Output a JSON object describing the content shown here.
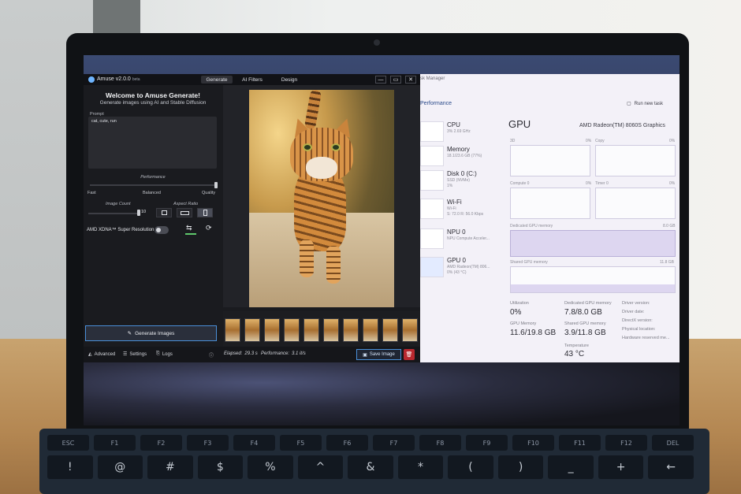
{
  "amuse": {
    "title": "Amuse v2.0.0",
    "beta": "beta",
    "tabs": [
      "Generate",
      "AI Filters",
      "Design"
    ],
    "window_buttons": [
      "—",
      "▭",
      "✕"
    ],
    "welcome_title": "Welcome to Amuse Generate!",
    "welcome_subtitle": "Generate images using AI and Stable Diffusion",
    "prompt_label": "Prompt",
    "prompt_value": "cat, cute, run",
    "performance_label": "Performance",
    "performance_options": [
      "Fast",
      "Balanced",
      "Quality"
    ],
    "performance_level": 1.0,
    "image_count_label": "Image Count",
    "image_count_value": "10",
    "aspect_ratio_label": "Aspect Ratio",
    "xdna_label": "AMD XDNA™ Super Resolution",
    "xdna_enabled": false,
    "generate_label": "Generate Images",
    "footer": {
      "advanced": "Advanced",
      "settings": "Settings",
      "logs": "Logs",
      "elapsed_label": "Elapsed:",
      "elapsed_value": "29.3 s",
      "performance_label": "Performance:",
      "performance_value": "3.1 it/s",
      "save_label": "Save Image"
    },
    "accent_color": "#4a8fd8",
    "delete_color": "#b8282f"
  },
  "taskmgr": {
    "title": "sk Manager",
    "section": "Performance",
    "run_new_task": "Run new task",
    "items": [
      {
        "name": "CPU",
        "line1": "3% 2.69 GHz",
        "line2": ""
      },
      {
        "name": "Memory",
        "line1": "18.1/23.6 GB (77%)",
        "line2": ""
      },
      {
        "name": "Disk 0 (C:)",
        "line1": "SSD (NVMe)",
        "line2": "1%"
      },
      {
        "name": "Wi-Fi",
        "line1": "Wi-Fi",
        "line2": "S: 72.0 R: 56.0 Kbps"
      },
      {
        "name": "NPU 0",
        "line1": "NPU Compute Acceler...",
        "line2": ""
      },
      {
        "name": "GPU 0",
        "line1": "AMD Radeon(TM) 806...",
        "line2": "0% (43 °C)"
      }
    ],
    "gpu_heading": "GPU",
    "gpu_name": "AMD Radeon(TM) 8060S Graphics",
    "graphs": [
      {
        "label": "3D",
        "pct": "0%"
      },
      {
        "label": "Copy",
        "pct": "0%"
      },
      {
        "label": "Compute 0",
        "pct": "0%"
      },
      {
        "label": "Timer 0",
        "pct": "0%"
      }
    ],
    "dedicated_label": "Dedicated GPU memory",
    "dedicated_max": "8.0 GB",
    "shared_label": "Shared GPU memory",
    "shared_max": "11.8 GB",
    "stats": {
      "utilization_label": "Utilization",
      "utilization_value": "0%",
      "dedicated_mem_label": "Dedicated GPU memory",
      "dedicated_mem_value": "7.8/8.0 GB",
      "gpu_memory_label": "GPU Memory",
      "gpu_memory_value": "11.6/19.8 GB",
      "shared_mem_label": "Shared GPU memory",
      "shared_mem_value": "3.9/11.8 GB",
      "temperature_label": "Temperature",
      "temperature_value": "43 °C"
    },
    "side_labels": [
      "Driver version:",
      "Driver date:",
      "DirectX version:",
      "Physical location:",
      "Hardware reserved me..."
    ]
  },
  "keyboard": {
    "row1": [
      "ESC",
      "F1",
      "F2",
      "F3",
      "F4",
      "F5",
      "F6",
      "F7",
      "F8",
      "F9",
      "F10",
      "F11",
      "F12",
      "DEL"
    ],
    "row2": [
      "!",
      "@",
      "#",
      "$",
      "%",
      "^",
      "&",
      "*",
      "(",
      ")",
      "_",
      "+",
      "←"
    ]
  }
}
